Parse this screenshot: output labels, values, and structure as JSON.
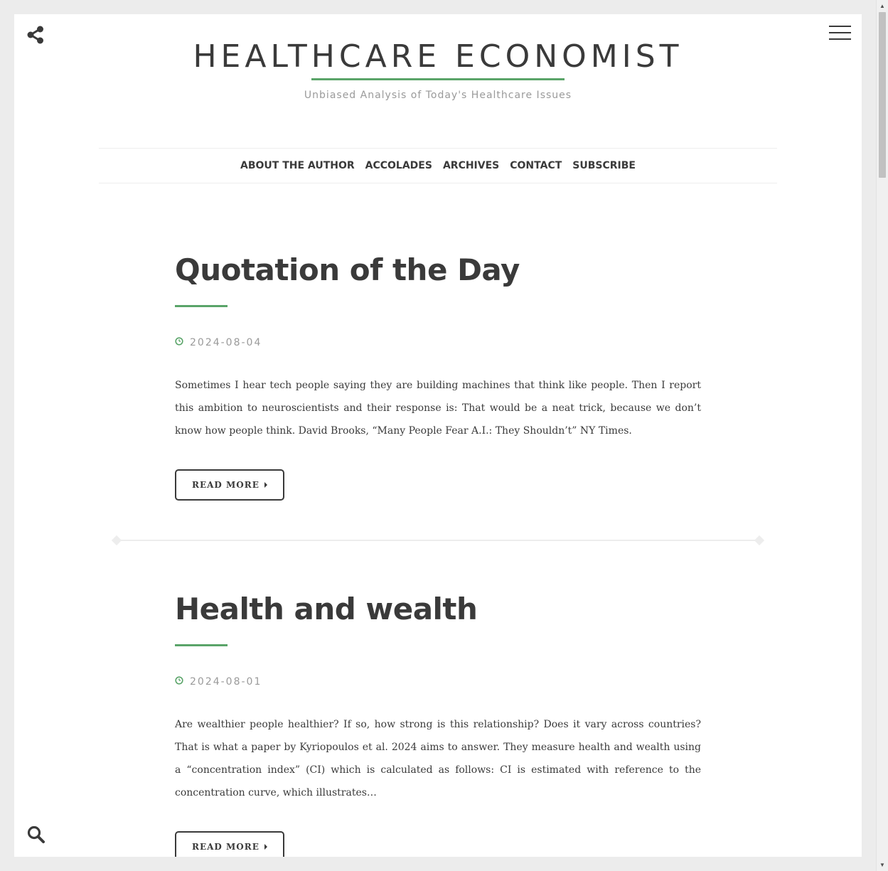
{
  "header": {
    "site_title": "HEALTHCARE ECONOMIST",
    "tagline": "Unbiased Analysis of Today's Healthcare Issues"
  },
  "nav": {
    "items": [
      {
        "label": "ABOUT THE AUTHOR"
      },
      {
        "label": "ACCOLADES"
      },
      {
        "label": "ARCHIVES"
      },
      {
        "label": "CONTACT"
      },
      {
        "label": "SUBSCRIBE"
      }
    ]
  },
  "posts": [
    {
      "title": "Quotation of the Day",
      "date": "2024-08-04",
      "excerpt": "Sometimes I hear tech people saying they are building machines that think like people. Then I report this ambition to neuroscientists and their response is: That would be a neat trick, because we don’t know how people think. David Brooks, “Many People Fear A.I.: They Shouldn’t” NY Times.",
      "read_more_label": "READ MORE"
    },
    {
      "title": "Health and wealth",
      "date": "2024-08-01",
      "excerpt": "Are wealthier people healthier? If so, how strong is this relationship? Does it vary across countries? That is what a paper by Kyriopoulos et al. 2024 aims to answer. They measure health and wealth using a “concentration index” (CI) which is calculated as follows: CI is estimated with reference to the concentration curve, which illustrates…",
      "read_more_label": "READ MORE"
    }
  ],
  "icons": {
    "share": "share-icon",
    "menu": "hamburger-menu-icon",
    "search": "search-icon",
    "clock": "clock-icon"
  },
  "colors": {
    "accent": "#5aa469",
    "text": "#3a3a3a",
    "muted": "#9a9a9a",
    "background": "#ececec"
  }
}
